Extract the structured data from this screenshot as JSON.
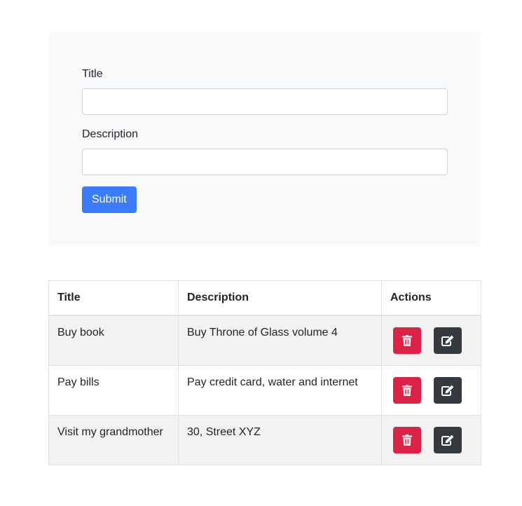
{
  "form": {
    "title_label": "Title",
    "title_value": "",
    "description_label": "Description",
    "description_value": "",
    "submit_label": "Submit"
  },
  "table": {
    "headers": [
      "Title",
      "Description",
      "Actions"
    ],
    "rows": [
      {
        "title": "Buy book",
        "description": "Buy Throne of Glass volume 4"
      },
      {
        "title": "Pay bills",
        "description": "Pay credit card, water and internet"
      },
      {
        "title": "Visit my grandmother",
        "description": "30, Street XYZ"
      }
    ],
    "actions": {
      "delete_icon": "trash-icon",
      "edit_icon": "edit-icon"
    }
  },
  "colors": {
    "primary": "#3b7cff",
    "danger": "#dc2347",
    "dark": "#343a40",
    "panel_bg": "#f8f9fa",
    "stripe_bg": "#f2f2f2"
  }
}
